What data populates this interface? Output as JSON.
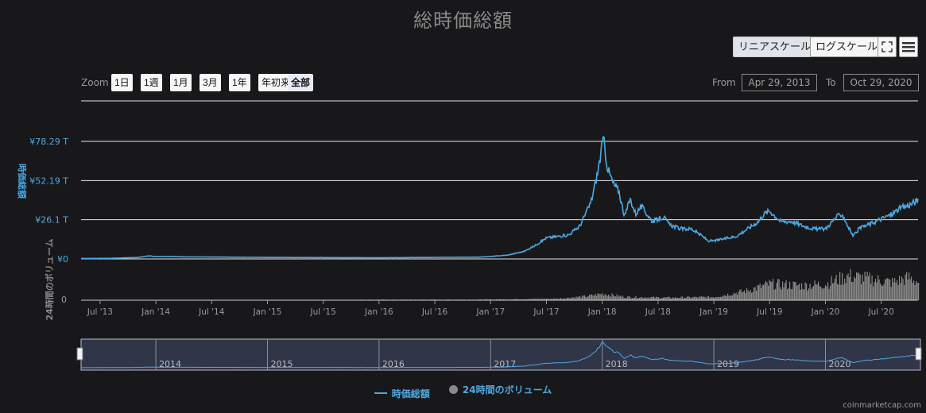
{
  "title": "総時価総額",
  "scale_buttons": {
    "linear": "リニアスケール",
    "log": "ログスケール"
  },
  "zoom": {
    "label": "Zoom",
    "buttons": [
      "1日",
      "1週",
      "1月",
      "3月",
      "1年",
      "年初来",
      "全部"
    ],
    "active": "全部"
  },
  "range": {
    "from_label": "From",
    "from_value": "Apr 29, 2013",
    "to_label": "To",
    "to_value": "Oct 29, 2020"
  },
  "legend": {
    "series1": "時価総額",
    "series2": "24時間のボリューム"
  },
  "credits": "coinmarketcap.com",
  "colors": {
    "accent": "#4fa8e0",
    "volume": "#8a8a8a",
    "background": "#18181b"
  },
  "icons": [
    "fullscreen-icon",
    "menu-icon"
  ],
  "chart_data": {
    "type": "line",
    "title": "総時価総額",
    "ylabel": "時価総額",
    "ylabel_volume": "24時間のボリューム",
    "yticks": [
      "¥0",
      "¥26.1 T",
      "¥52.19 T",
      "¥78.29 T"
    ],
    "yticks_volume": [
      "0"
    ],
    "ylim": [
      0,
      78.29
    ],
    "xtick_labels": [
      "Jul '13",
      "Jan '14",
      "Jul '14",
      "Jan '15",
      "Jul '15",
      "Jan '16",
      "Jul '16",
      "Jan '17",
      "Jul '17",
      "Jan '18",
      "Jul '18",
      "Jan '19",
      "Jul '19",
      "Jan '20",
      "Jul '20"
    ],
    "xtick_dates": [
      2013.5,
      2014.0,
      2014.5,
      2015.0,
      2015.5,
      2016.0,
      2016.5,
      2017.0,
      2017.5,
      2018.0,
      2018.5,
      2019.0,
      2019.5,
      2020.0,
      2020.5
    ],
    "navigator_labels": [
      "2014",
      "2015",
      "2016",
      "2017",
      "2018",
      "2019",
      "2020"
    ],
    "navigator_dates": [
      2014.0,
      2015.0,
      2016.0,
      2017.0,
      2018.0,
      2019.0,
      2020.0
    ],
    "x_range": [
      2013.33,
      2020.83
    ],
    "series": [
      {
        "name": "時価総額",
        "x": [
          2013.33,
          2013.6,
          2013.85,
          2013.93,
          2014.0,
          2014.3,
          2014.6,
          2015.0,
          2015.5,
          2016.0,
          2016.5,
          2016.9,
          2017.0,
          2017.15,
          2017.3,
          2017.4,
          2017.5,
          2017.6,
          2017.7,
          2017.8,
          2017.9,
          2017.96,
          2018.01,
          2018.05,
          2018.1,
          2018.15,
          2018.2,
          2018.25,
          2018.3,
          2018.35,
          2018.45,
          2018.55,
          2018.6,
          2018.7,
          2018.8,
          2018.9,
          2018.95,
          2019.0,
          2019.2,
          2019.4,
          2019.45,
          2019.5,
          2019.6,
          2019.7,
          2019.8,
          2019.9,
          2020.0,
          2020.1,
          2020.15,
          2020.2,
          2020.25,
          2020.3,
          2020.45,
          2020.6,
          2020.65,
          2020.75,
          2020.83
        ],
        "values": [
          0.3,
          0.4,
          1.0,
          2.0,
          1.6,
          1.4,
          1.2,
          1.0,
          0.9,
          0.8,
          1.0,
          1.2,
          1.6,
          2.5,
          5.0,
          9.0,
          14.0,
          15.0,
          16.0,
          22.0,
          38.0,
          58.0,
          80.0,
          60.0,
          50.0,
          45.0,
          28.0,
          40.0,
          30.0,
          35.0,
          25.0,
          28.0,
          23.0,
          20.0,
          20.0,
          15.0,
          12.0,
          12.0,
          15.0,
          25.0,
          30.0,
          32.0,
          25.0,
          25.0,
          22.0,
          20.0,
          20.0,
          28.0,
          30.0,
          22.0,
          15.0,
          20.0,
          25.0,
          30.0,
          33.0,
          36.0,
          39.0
        ]
      },
      {
        "name": "24時間のボリューム",
        "x": [
          2013.33,
          2016.9,
          2017.6,
          2017.85,
          2018.0,
          2018.2,
          2018.6,
          2019.0,
          2019.3,
          2019.5,
          2019.8,
          2020.0,
          2020.2,
          2020.4,
          2020.6,
          2020.75,
          2020.83
        ],
        "values": [
          0.0,
          0.02,
          0.05,
          0.12,
          0.2,
          0.1,
          0.08,
          0.1,
          0.3,
          0.5,
          0.45,
          0.5,
          0.75,
          0.65,
          0.55,
          0.7,
          0.55
        ]
      }
    ]
  }
}
